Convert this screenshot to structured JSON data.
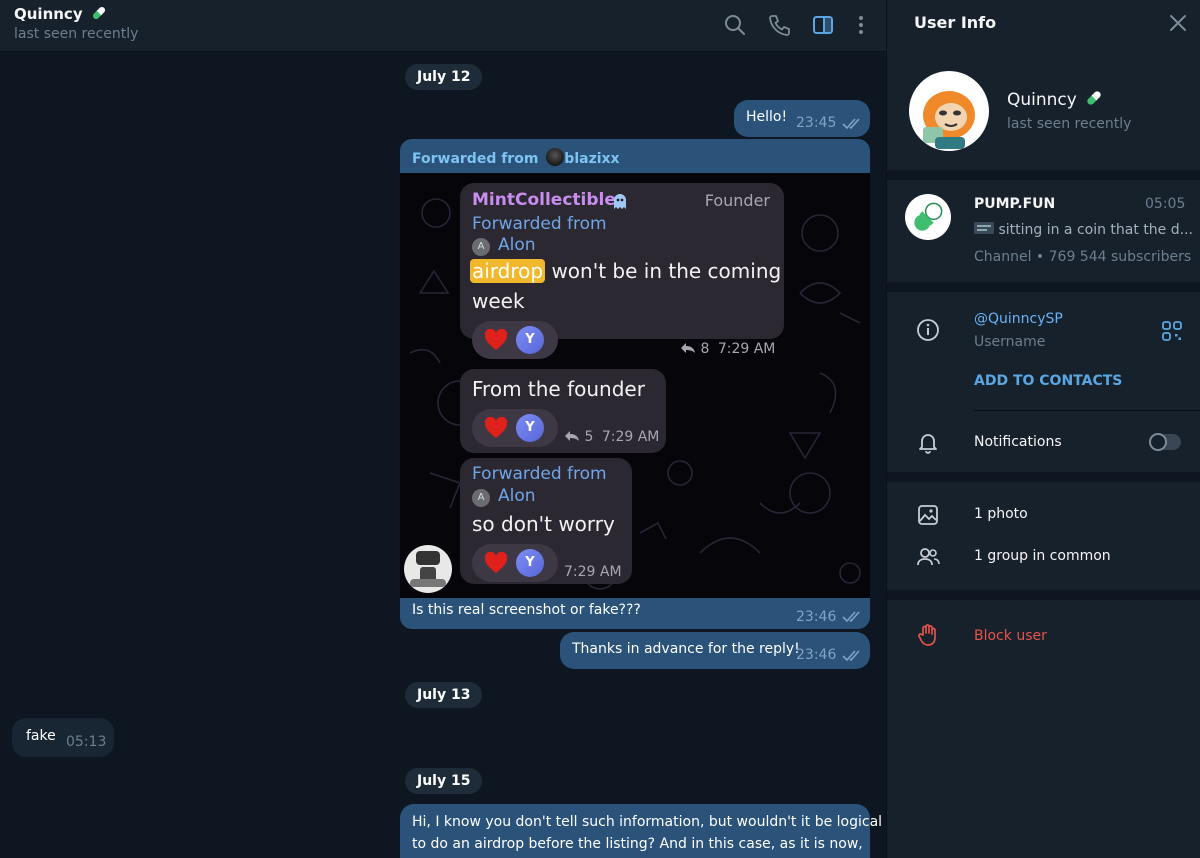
{
  "header": {
    "name": "Quinncy",
    "status": "last seen recently"
  },
  "dates": [
    "July 12",
    "July 13",
    "July 15"
  ],
  "messages": {
    "hello": {
      "text": "Hello!",
      "time": "23:45"
    },
    "forward": {
      "label": "Forwarded from",
      "from": "blazixx",
      "caption": "Is this real screenshot or fake???",
      "time": "23:46"
    },
    "thanks": {
      "text": "Thanks in advance for the reply!",
      "time": "23:46"
    },
    "fake": {
      "text": "fake",
      "time": "05:13"
    },
    "long": {
      "line1": "Hi, I know you don't tell such information, but wouldn't it be logical",
      "line2": "to do an airdrop before the listing? And in this case, as it is now,"
    }
  },
  "screenshot": {
    "msg1": {
      "sender": "MintCollectible",
      "role": "Founder",
      "fwd_label": "Forwarded from",
      "fwd_from": "Alon",
      "fwd_initial": "A",
      "highlight": "airdrop",
      "text_rest": " won't be in the coming",
      "text_line2": "week",
      "replies": "8",
      "time": "7:29 AM",
      "reactor": "Y"
    },
    "msg2": {
      "text": "From the founder",
      "replies": "5",
      "time": "7:29 AM",
      "reactor": "Y"
    },
    "msg3": {
      "fwd_label": "Forwarded from",
      "fwd_from": "Alon",
      "fwd_initial": "A",
      "text": "so don't worry",
      "time": "7:29 AM",
      "reactor": "Y"
    }
  },
  "sidebar": {
    "title": "User Info",
    "name": "Quinncy",
    "status": "last seen recently",
    "channel": {
      "name": "PUMP.FUN",
      "time": "05:05",
      "preview": "sitting in a coin that the d...",
      "meta": "Channel • 769 544 subscribers"
    },
    "username": "@QuinncySP",
    "username_label": "Username",
    "add_contacts": "ADD TO CONTACTS",
    "notifications": "Notifications",
    "photos": "1 photo",
    "groups": "1 group in common",
    "block": "Block user"
  },
  "colors": {
    "background": "#0e1621",
    "panel": "#17212b",
    "outgoing": "#2b5278",
    "incoming": "#182533",
    "accent": "#5aa6e3",
    "danger": "#e5534b"
  },
  "icons": [
    "search-icon",
    "phone-icon",
    "sidebar-toggle-icon",
    "more-icon",
    "close-icon",
    "info-icon",
    "qr-icon",
    "bell-icon",
    "photo-icon",
    "group-icon",
    "block-hand-icon",
    "pill-icon"
  ]
}
